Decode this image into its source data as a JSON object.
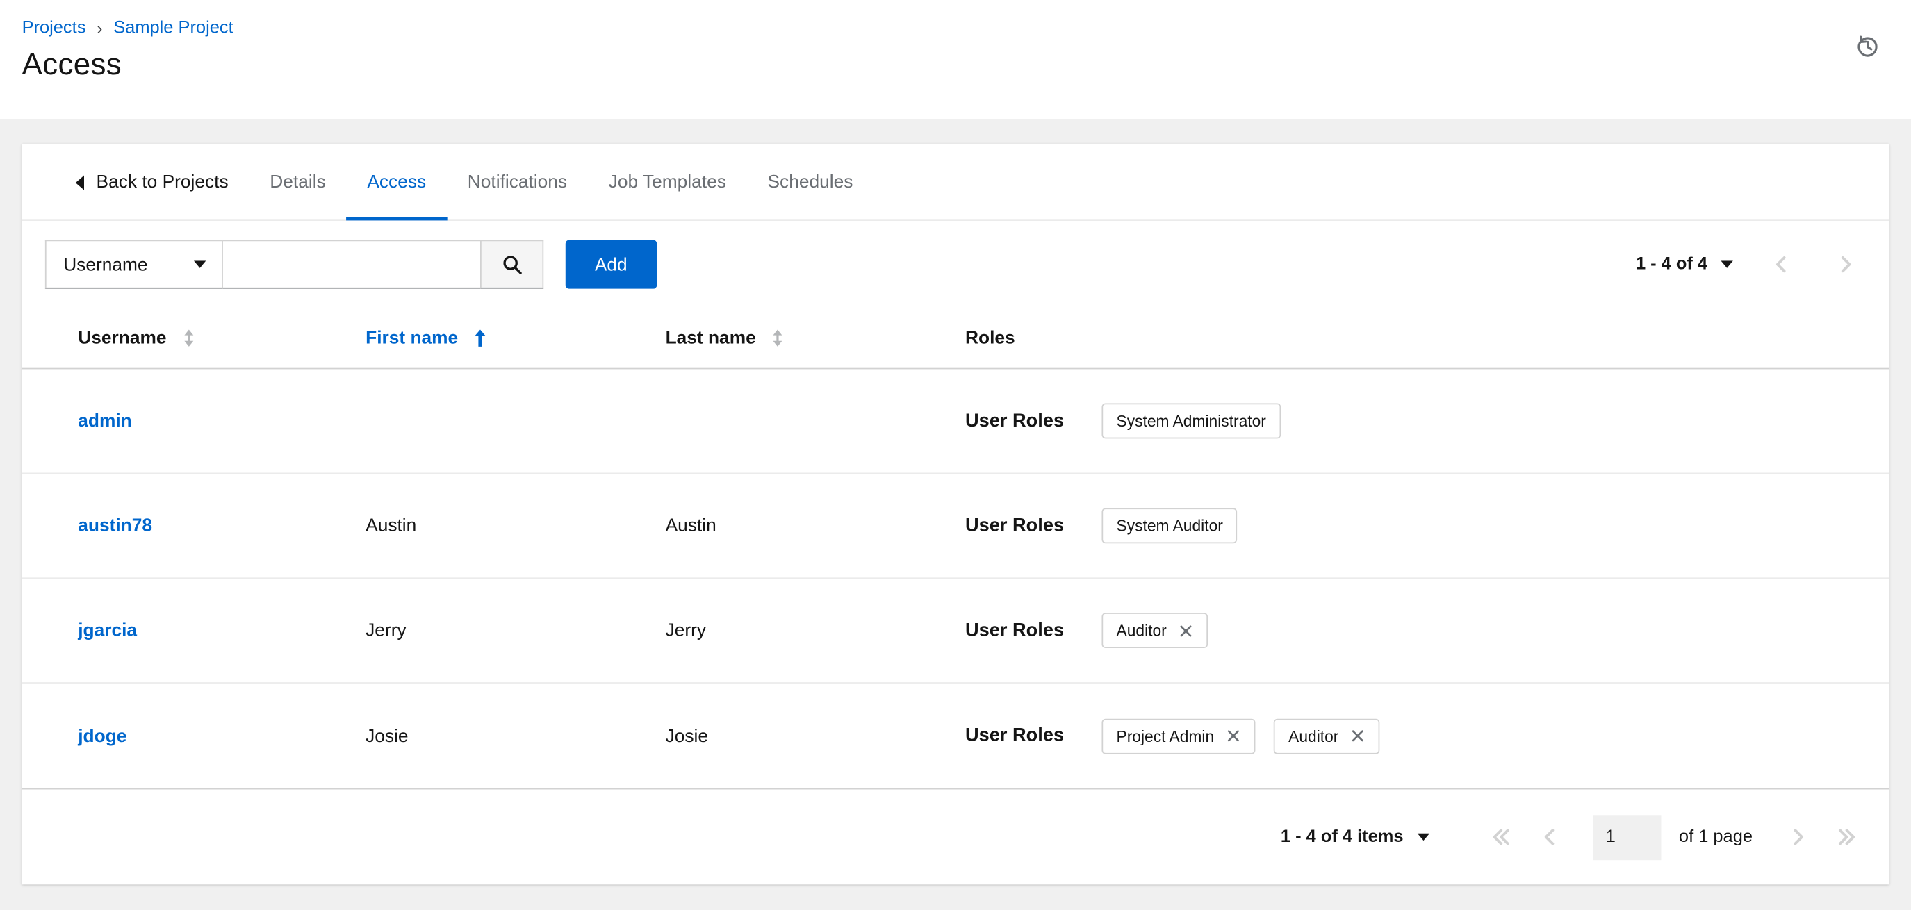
{
  "colors": {
    "accent": "#0066cc",
    "link": "#0066cc"
  },
  "breadcrumb": {
    "divider": "›",
    "items": [
      {
        "label": "Projects"
      },
      {
        "label": "Sample Project"
      }
    ]
  },
  "page": {
    "title": "Access"
  },
  "tabs": {
    "back_label": "Back to Projects",
    "items": [
      {
        "label": "Details",
        "active": false
      },
      {
        "label": "Access",
        "active": true
      },
      {
        "label": "Notifications",
        "active": false
      },
      {
        "label": "Job Templates",
        "active": false
      },
      {
        "label": "Schedules",
        "active": false
      }
    ]
  },
  "toolbar": {
    "filter_selected": "Username",
    "search_value": "",
    "add_label": "Add",
    "pagination_summary": "1 - 4 of 4"
  },
  "table": {
    "columns": [
      {
        "label": "Username",
        "sort": "none"
      },
      {
        "label": "First name",
        "sort": "ascending"
      },
      {
        "label": "Last name",
        "sort": "none"
      },
      {
        "label": "Roles",
        "sort": null
      }
    ],
    "user_roles_label": "User Roles",
    "rows": [
      {
        "username": "admin",
        "first_name": "",
        "last_name": "",
        "roles": [
          {
            "label": "System Administrator",
            "removable": false
          }
        ]
      },
      {
        "username": "austin78",
        "first_name": "Austin",
        "last_name": "Austin",
        "roles": [
          {
            "label": "System Auditor",
            "removable": false
          }
        ]
      },
      {
        "username": "jgarcia",
        "first_name": "Jerry",
        "last_name": "Jerry",
        "roles": [
          {
            "label": "Auditor",
            "removable": true
          }
        ]
      },
      {
        "username": "jdoge",
        "first_name": "Josie",
        "last_name": "Josie",
        "roles": [
          {
            "label": "Project Admin",
            "removable": true
          },
          {
            "label": "Auditor",
            "removable": true
          }
        ]
      }
    ]
  },
  "footer": {
    "items_summary": "1 - 4 of 4 items",
    "current_page": "1",
    "page_label": "of 1 page"
  }
}
